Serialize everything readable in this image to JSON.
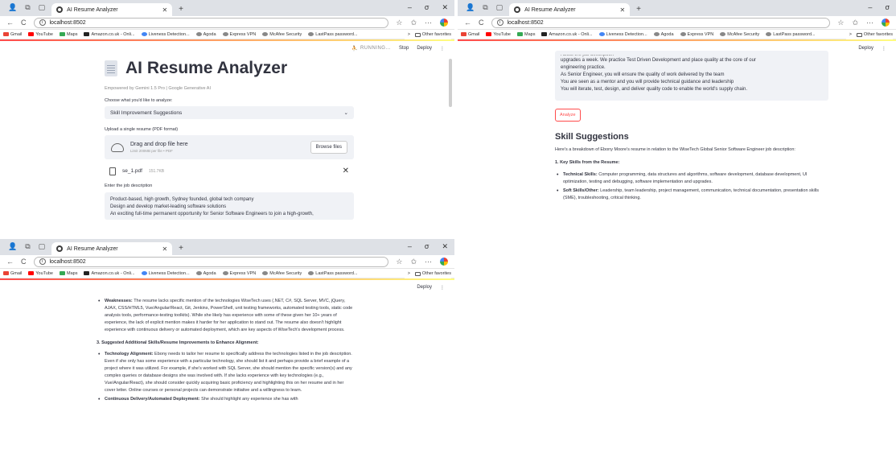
{
  "browser": {
    "tab_title": "AI Resume Analyzer",
    "new_tab": "+",
    "url": "localhost:8502",
    "window_controls": [
      "–",
      "σ",
      "✕"
    ],
    "bookmarks": [
      "Gmail",
      "YouTube",
      "Maps",
      "Amazon.co.uk - Onli...",
      "Liveness Detection...",
      "Agoda",
      "Express VPN",
      "McAfee Security",
      "LastPass password..."
    ],
    "bookmark_colors": [
      "#ea4335",
      "#ff0000",
      "#34a853",
      "#222222",
      "#4285f4",
      "#888888",
      "#888888",
      "#888888",
      "#888888"
    ],
    "other_favorites": "Other favorites",
    "more_chevron": ">"
  },
  "streamlit": {
    "running": "RUNNING...",
    "stop": "Stop",
    "deploy": "Deploy",
    "menu": "⋮"
  },
  "screen1": {
    "title": "AI Resume Analyzer",
    "caption": "Empowered by Gemini 1.5 Pro | Google Generative AI",
    "choose_label": "Choose what you'd like to analyze:",
    "selected_option": "Skill Improvement Suggestions",
    "upload_label": "Upload a single resume (PDF format)",
    "drop_text": "Drag and drop file here",
    "limit_text": "Limit 200MB per file • PDF",
    "browse_label": "Browse files",
    "file_name": "se_1.pdf",
    "file_size": "151.7KB",
    "job_label": "Enter the job description",
    "job_lines": [
      "Product-based, high growth, Sydney founded, global tech company",
      "Design and develop market-leading software solutions",
      "An exciting full-time permanent opportunity for Senior Software Engineers to join a high-growth,"
    ]
  },
  "screen2": {
    "partial_top": "About the job description",
    "job_lines": [
      "upgrades a week. We practice Test Driven Development and place quality at the core of our",
      "engineering practice.",
      "As Senior Engineer, you will ensure the quality of work delivered by the team",
      "You are seen as a mentor and you will provide technical guidance and leadership",
      "You will iterate, test, design, and deliver quality code to enable the world's supply chain."
    ],
    "analyze_label": "Analyze",
    "section_title": "Skill Suggestions",
    "intro": "Here's a breakdown of Ebony Moore's resume in relation to the WiseTech Global Senior Software Engineer job description:",
    "heading1": "1. Key Skills from the Resume:",
    "bullets": [
      {
        "label": "Technical Skills:",
        "text": " Computer programming, data structures and algorithms, software development, database development, UI optimization, testing and debugging, software implementation and upgrades."
      },
      {
        "label": "Soft Skills/Other:",
        "text": " Leadership, team leadership, project management, communication, technical documentation, presentation skills (SME), troubleshooting, critical thinking."
      }
    ]
  },
  "screen3": {
    "weakness_label": "Weaknesses:",
    "weakness_text": " The resume lacks specific mention of the technologies WiseTech uses (.NET, C#, SQL Server, MVC, jQuery, AJAX, CSS/HTML5, Vue/Angular/React, Git, Jenkins, PowerShell, unit testing frameworks, automated testing tools, static code analysis tools, performance-testing toolkits). While she likely has experience with some of these given her 10+ years of experience, the lack of explicit mention makes it harder for her application to stand out. The resume also doesn't highlight experience with continuous delivery or automated deployment, which are key aspects of WiseTech's development process.",
    "heading3": "3. Suggested Additional Skills/Resume Improvements to Enhance Alignment:",
    "tech_label": "Technology Alignment:",
    "tech_text": " Ebony needs to tailor her resume to specifically address the technologies listed in the job description. Even if she only has some experience with a particular technology, she should list it and perhaps provide a brief example of a project where it was utilized. For example, if she's worked with SQL Server, she should mention the specific version(s) and any complex queries or database designs she was involved with. If she lacks experience with key technologies (e.g., Vue/Angular/React), she should consider quickly acquiring basic proficiency and highlighting this on her resume and in her cover letter. Online courses or personal projects can demonstrate initiative and a willingness to learn.",
    "cd_label": "Continuous Delivery/Automated Deployment:",
    "cd_text": " She should highlight any experience she has with"
  }
}
